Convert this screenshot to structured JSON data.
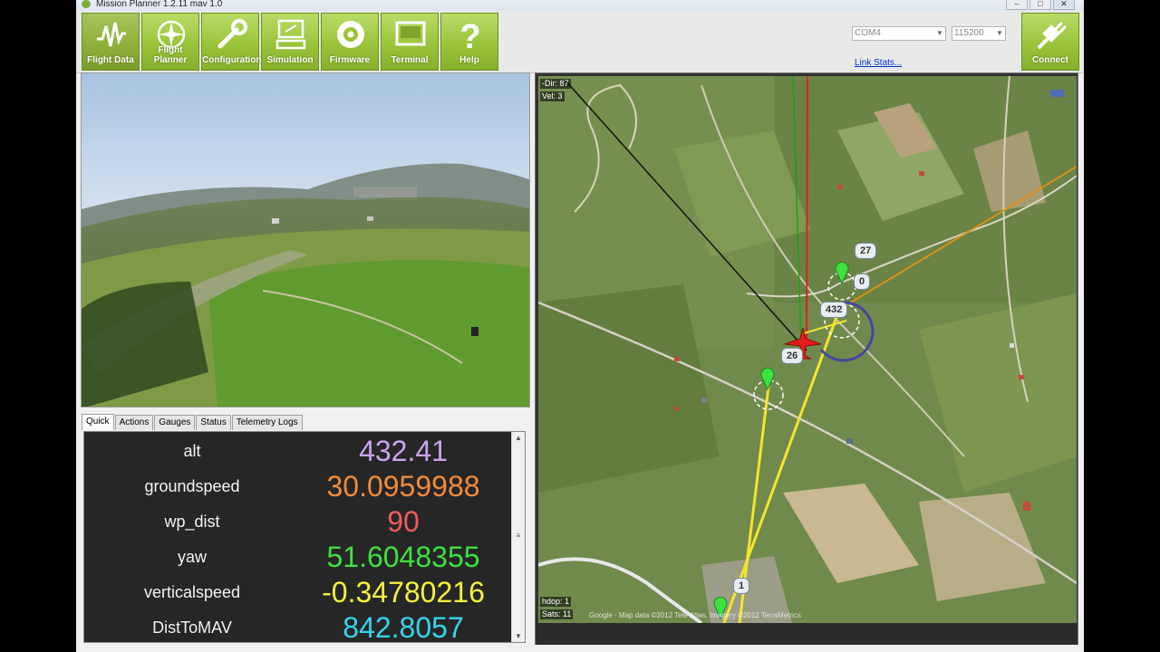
{
  "window": {
    "title": "Mission Planner 1.2.11 mav 1.0",
    "controls": {
      "minimize": "–",
      "maximize": "□",
      "close": "✕"
    }
  },
  "toolbar": {
    "buttons": [
      {
        "label": "Flight Data",
        "icon": "flight-data-icon",
        "active": true
      },
      {
        "label": "Flight Planner",
        "icon": "compass-icon",
        "active": false
      },
      {
        "label": "Configuration",
        "icon": "wrench-icon",
        "active": false
      },
      {
        "label": "Simulation",
        "icon": "simulation-icon",
        "active": false
      },
      {
        "label": "Firmware",
        "icon": "disc-icon",
        "active": false
      },
      {
        "label": "Terminal",
        "icon": "terminal-icon",
        "active": false
      },
      {
        "label": "Help",
        "icon": "question-icon",
        "active": false
      }
    ],
    "port": "COM4",
    "baud": "115200",
    "link_stats": "Link Stats...",
    "connect_label": "Connect",
    "connect_icon": "plug-icon"
  },
  "tabs": [
    "Quick",
    "Actions",
    "Gauges",
    "Status",
    "Telemetry Logs"
  ],
  "quick": [
    {
      "label": "alt",
      "value": "432.41",
      "color": "#c9a3f0"
    },
    {
      "label": "groundspeed",
      "value": "30.0959988",
      "color": "#f08a3c"
    },
    {
      "label": "wp_dist",
      "value": "90",
      "color": "#ef5b5b"
    },
    {
      "label": "yaw",
      "value": "51.6048355",
      "color": "#3ee03e"
    },
    {
      "label": "verticalspeed",
      "value": "-0.34780216",
      "color": "#f4f040"
    },
    {
      "label": "DistToMAV",
      "value": "842.8057",
      "color": "#36d4ee"
    }
  ],
  "map": {
    "dir": "-Dir: 87",
    "vel": "Vel: 3",
    "hdop": "hdop: 1",
    "sats": "Sats: 11",
    "copyright": "Google - Map data ©2012 Tele Atlas, Imagery ©2012 TerraMetrics",
    "waypoints": [
      "27",
      "0",
      "432",
      "26",
      "1"
    ]
  }
}
